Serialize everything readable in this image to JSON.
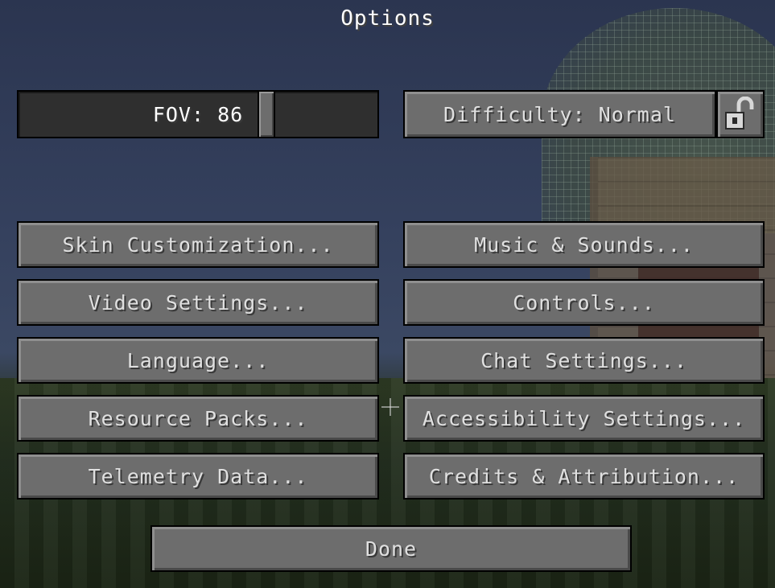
{
  "title": "Options",
  "fov_slider": {
    "label": "FOV: 86",
    "value": 86
  },
  "difficulty_button": {
    "label": "Difficulty: Normal"
  },
  "difficulty_lock": {
    "icon": "unlocked-padlock-icon",
    "locked": false
  },
  "buttons": {
    "skin_customization": "Skin Customization...",
    "music_sounds": "Music & Sounds...",
    "video_settings": "Video Settings...",
    "controls": "Controls...",
    "language": "Language...",
    "chat_settings": "Chat Settings...",
    "resource_packs": "Resource Packs...",
    "accessibility_settings": "Accessibility Settings...",
    "telemetry_data": "Telemetry Data...",
    "credits_attribution": "Credits & Attribution...",
    "done": "Done"
  },
  "colors": {
    "button_face": "#6d6d6d",
    "button_border": "#000000",
    "text": "#ffffff"
  }
}
